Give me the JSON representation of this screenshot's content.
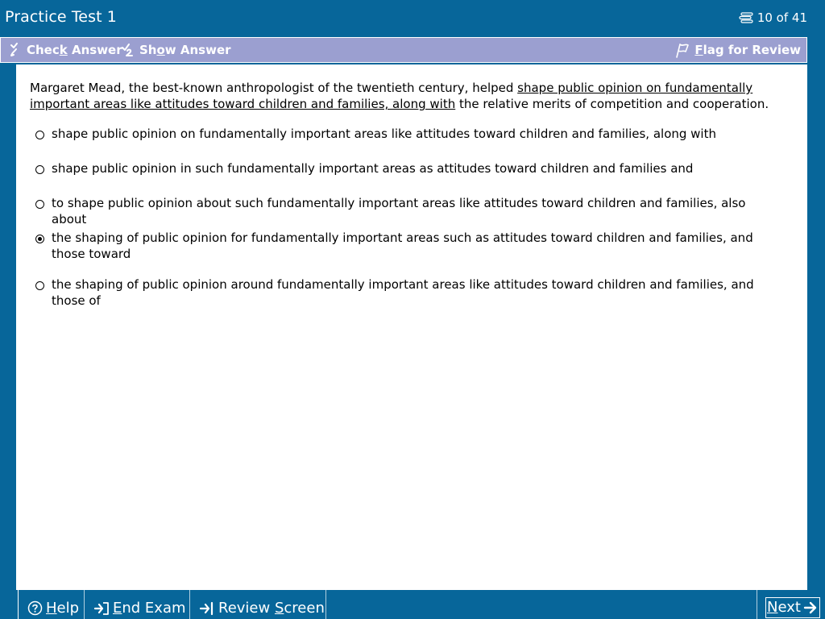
{
  "window": {
    "title": "Practice Test 1",
    "progress": "10 of 41"
  },
  "toolbar": {
    "check_answer": {
      "pre": "Chec",
      "key": "k",
      "post": " Answer"
    },
    "show_answer": {
      "pre": "Sh",
      "key": "o",
      "post": "w Answer"
    },
    "flag_review": {
      "pre": "",
      "key": "F",
      "post": "lag for Review"
    }
  },
  "question": {
    "stem_before": "Margaret Mead, the best-known anthropologist of the twentieth century, helped ",
    "stem_underlined": "shape public opinion on fundamentally important areas like attitudes toward children and families, along with",
    "stem_after": " the relative merits of competition and cooperation.",
    "selected_index": 3,
    "options": [
      "shape public opinion on fundamentally important areas like attitudes toward children and families, along with",
      "shape public opinion in such fundamentally important areas as attitudes toward children and families and",
      "to shape public opinion about such fundamentally important areas like attitudes toward children and families, also about",
      "the shaping of public opinion for fundamentally important areas such as attitudes toward children and families, and those toward",
      "the shaping of public opinion around fundamentally important areas like attitudes toward children and families, and those of"
    ]
  },
  "bottom": {
    "help": {
      "key": "H",
      "post": "elp"
    },
    "end_exam": {
      "key": "E",
      "post": "nd Exam"
    },
    "review_screen": {
      "pre": "Review ",
      "key": "S",
      "post": "creen"
    },
    "next": {
      "key": "N",
      "post": "ext"
    }
  },
  "colors": {
    "frame": "#07669a",
    "toolbar": "#9b9fd0",
    "content": "#ffffff"
  },
  "icons": [
    "list-icon",
    "check-answer-icon",
    "show-answer-icon",
    "flag-icon",
    "help-icon",
    "end-exam-icon",
    "review-screen-icon",
    "next-arrow-icon"
  ]
}
